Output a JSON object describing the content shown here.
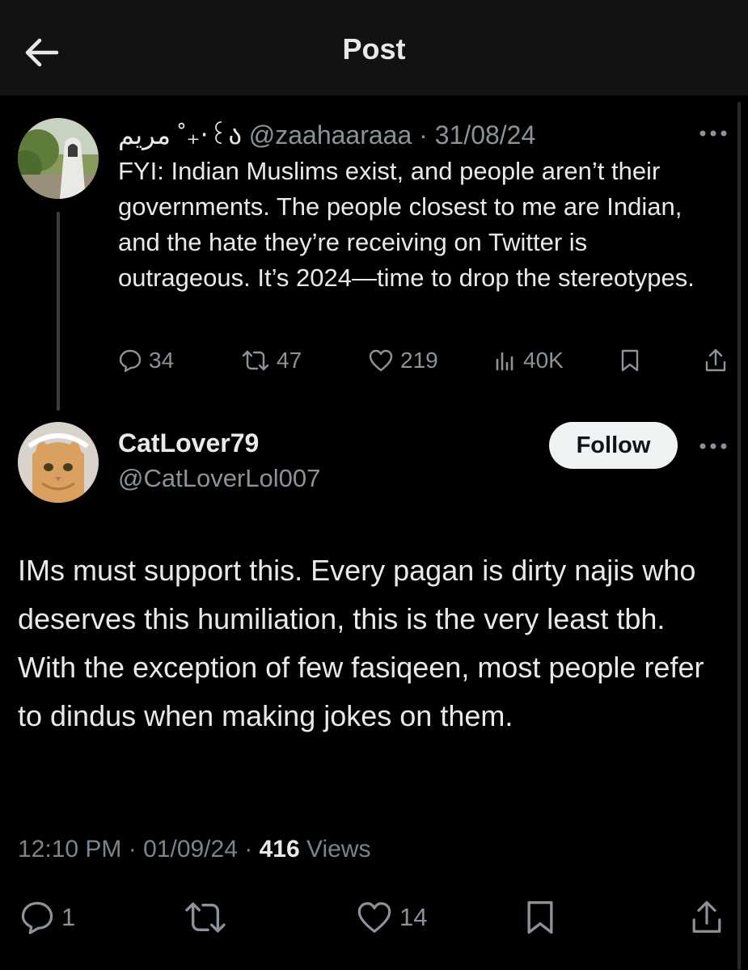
{
  "header": {
    "title": "Post"
  },
  "original_post": {
    "display_name": "مريم ˚₊‧꒰ა",
    "handle": "@zaahaaraaa",
    "date": "31/08/24",
    "separator": "·",
    "text": "FYI: Indian Muslims exist, and people aren’t their governments. The people closest to me are Indian, and the hate they’re receiving on Twitter is outrageous. It’s 2024—time to drop the stereotypes.",
    "stats": {
      "replies": "34",
      "reposts": "47",
      "likes": "219",
      "views": "40K"
    }
  },
  "reply": {
    "display_name": "CatLover79",
    "handle": "@CatLoverLol007",
    "follow_label": "Follow",
    "text": "IMs must support this. Every pagan is dirty najis who deserves this humiliation, this is the very least tbh. With the exception of few fasiqeen, most people refer to dindus when making jokes on them.",
    "time": "12:10 PM",
    "date": "01/09/24",
    "separator": "·",
    "views_count": "416",
    "views_label": "Views",
    "stats": {
      "replies": "1",
      "likes": "14"
    }
  },
  "colors": {
    "background": "#000000",
    "header_background": "#121212",
    "text": "#e7e9ea",
    "muted": "#8b9299",
    "follow_button": "#eff3f4"
  },
  "icons": [
    "back-arrow-icon",
    "more-icon",
    "reply-icon",
    "repost-icon",
    "like-icon",
    "views-icon",
    "bookmark-icon",
    "share-icon"
  ]
}
